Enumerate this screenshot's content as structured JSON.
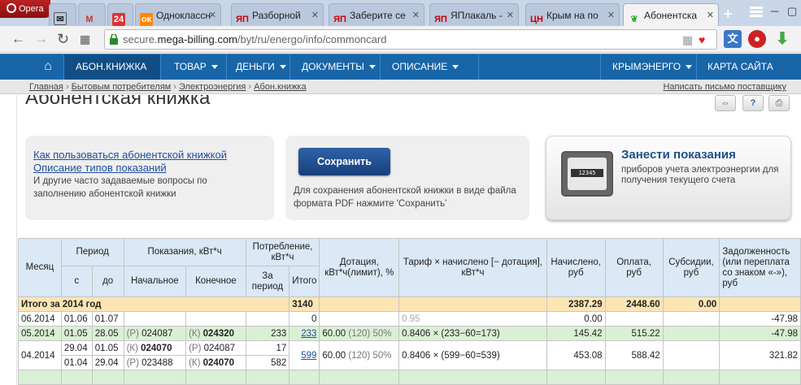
{
  "browser": {
    "opera_label": "Opera",
    "tabs": [
      {
        "label": "",
        "icon": "mail-icon"
      },
      {
        "label": "",
        "icon": "gmail-icon"
      },
      {
        "label": "",
        "icon": "24-icon"
      },
      {
        "label": "Одноклассн",
        "icon": "ok-icon"
      },
      {
        "label": "Разборной",
        "icon": "yap-icon"
      },
      {
        "label": "Заберите се",
        "icon": "yap-icon"
      },
      {
        "label": "ЯПлакаль -",
        "icon": "yap-icon"
      },
      {
        "label": "Крым на по",
        "icon": "cn-icon"
      },
      {
        "label": "Абонентска",
        "icon": "leaf-icon"
      }
    ],
    "url_prefix": "secure.",
    "url_domain": "mega-billing.com",
    "url_path": "/byt/ru/energo/info/commoncard"
  },
  "nav": {
    "items": [
      {
        "label": "АБОН.КНИЖКА",
        "caret": false
      },
      {
        "label": "ТОВАР",
        "caret": true
      },
      {
        "label": "ДЕНЬГИ",
        "caret": true
      },
      {
        "label": "ДОКУМЕНТЫ",
        "caret": true
      },
      {
        "label": "ОПИСАНИЕ",
        "caret": true
      }
    ],
    "right_items": [
      {
        "label": "КРЫМЭНЕРГО",
        "caret": true
      },
      {
        "label": "КАРТА САЙТА",
        "caret": false
      }
    ]
  },
  "breadcrumb": {
    "items": [
      "Главная",
      "Бытовым потребителям",
      "Электроэнергия",
      "Абон.книжка"
    ],
    "sep": "›",
    "right_link": "Написать письмо поставщику"
  },
  "page": {
    "title": "Абонентская книжка",
    "help": {
      "link1": "Как пользоваться абонентской книжкой",
      "link2": "Описание типов показаний",
      "text": "И другие часто задаваемые вопросы по заполнению абонентской книжки"
    },
    "save": {
      "button": "Сохранить",
      "text": "Для сохранения абонентской книжки в виде файла формата PDF нажмите 'Сохранить'"
    },
    "meter": {
      "title": "Занести показания",
      "text": "приборов учета электроэнергии для получения текущего счета",
      "digits": "12345"
    }
  },
  "table": {
    "headers": {
      "month": "Месяц",
      "period": "Период",
      "from": "с",
      "to": "до",
      "readings": "Показания, кВт*ч",
      "start": "Начальное",
      "end": "Конечное",
      "consumption": "Потребление, кВт*ч",
      "per_period": "За период",
      "total": "Итого",
      "subsidy_limit": "Дотация, кВт*ч(лимит), %",
      "tariff": "Тариф × начислено [− дотация], кВт*ч",
      "charged": "Начислено, руб",
      "paid": "Оплата, руб",
      "subsidies": "Субсидии, руб",
      "debt": "Задолженность (или переплата со знаком «-»), руб"
    },
    "total_row": {
      "label": "Итого за 2014 год",
      "total": "3140",
      "charged": "2387.29",
      "paid": "2448.60",
      "subsidies": "0.00"
    },
    "rows": [
      {
        "month": "06.2014",
        "from": "01.06",
        "to": "01.07",
        "start_tag": "",
        "start": "",
        "end_tag": "",
        "end": "",
        "per": "",
        "total": "0",
        "subsidy": "",
        "tariff": "0.95",
        "charged": "0.00",
        "paid": "",
        "subs": "",
        "debt": "-47.98"
      },
      {
        "month": "05.2014",
        "from": "01.05",
        "to": "28.05",
        "start_tag": "(Р)",
        "start": "024087",
        "end_tag": "(К)",
        "end": "024320",
        "per": "233",
        "total": "233",
        "subsidy": "60.00",
        "sub_limit": "(120)",
        "sub_pct": "50%",
        "tariff": "0.8406 × (233−60=173)",
        "charged": "145.42",
        "paid": "515.22",
        "subs": "",
        "debt": "-47.98"
      },
      {
        "month": "04.2014",
        "from": "29.04",
        "to": "01.05",
        "start_tag": "(К)",
        "start": "024070",
        "end_tag": "(Р)",
        "end": "024087",
        "per": "17",
        "total": "599",
        "subsidy": "60.00",
        "sub_limit": "(120)",
        "sub_pct": "50%",
        "tariff": "0.8406 × (599−60=539)",
        "charged": "453.08",
        "paid": "588.42",
        "subs": "",
        "debt": "321.82"
      },
      {
        "month": "",
        "from": "01.04",
        "to": "29.04",
        "start_tag": "(Р)",
        "start": "023488",
        "end_tag": "(К)",
        "end": "024070",
        "per": "582"
      }
    ]
  },
  "colors": {
    "nav_bg": "#1865a8",
    "header_bg": "#dbe8f5",
    "total_bg": "#fde5b3",
    "green_row_bg": "#daf0d4",
    "link": "#1f4fa0"
  }
}
